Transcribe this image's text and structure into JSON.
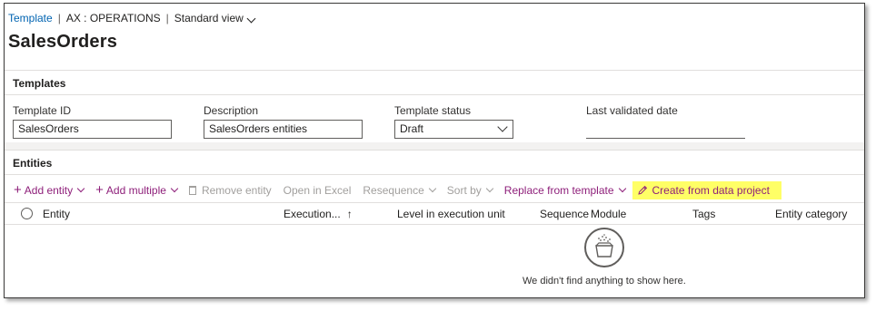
{
  "topbar": {
    "crumb": "Template",
    "company": "AX : OPERATIONS",
    "view": "Standard view"
  },
  "page": {
    "title": "SalesOrders"
  },
  "templates_section": {
    "header": "Templates",
    "fields": {
      "template_id": {
        "label": "Template ID",
        "value": "SalesOrders"
      },
      "description": {
        "label": "Description",
        "value": "SalesOrders entities"
      },
      "template_status": {
        "label": "Template status",
        "value": "Draft"
      },
      "last_validated": {
        "label": "Last validated date",
        "value": ""
      }
    }
  },
  "entities_section": {
    "header": "Entities",
    "toolbar": {
      "add_entity": "Add entity",
      "add_multiple": "Add multiple",
      "remove_entity": "Remove entity",
      "open_in_excel": "Open in Excel",
      "resequence": "Resequence",
      "sort_by": "Sort by",
      "replace_from_template": "Replace from template",
      "create_from_data_project": "Create from data project"
    },
    "columns": {
      "entity": "Entity",
      "execution": "Execution...",
      "level": "Level in execution unit",
      "sequence": "Sequence",
      "module": "Module",
      "tags": "Tags",
      "entity_category": "Entity category"
    },
    "empty_message": "We didn't find anything to show here."
  },
  "colors": {
    "link": "#0063b1",
    "action": "#8e1f7a",
    "highlight": "#ffff66",
    "disabled": "#a19f9d"
  },
  "icons": [
    "chevron-down-icon",
    "plus-icon",
    "trash-icon",
    "pencil-icon",
    "sort-up-arrow-icon",
    "radio-icon",
    "empty-box-icon"
  ]
}
